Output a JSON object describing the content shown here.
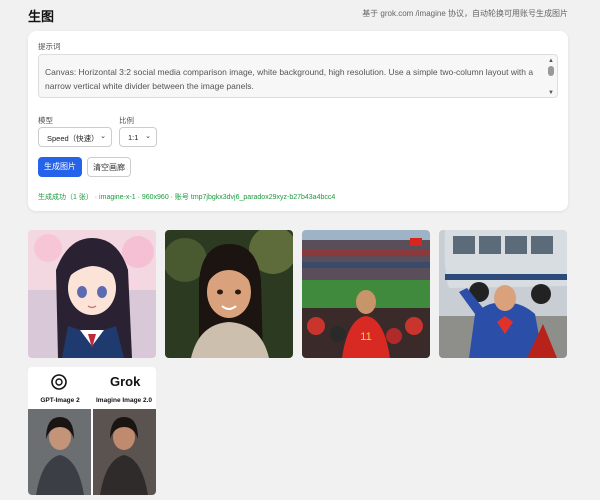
{
  "header": {
    "title": "生图",
    "note": "基于 grok.com /imagine 协议，自动轮换可用账号生成图片"
  },
  "form": {
    "prompt_label": "提示词",
    "prompt_text": "Canvas: Horizontal 3:2 social media comparison image, white background, high resolution. Use a simple two-column layout with a narrow vertical white divider between the image panels.",
    "model_label": "模型",
    "model_value": "Speed（快速）",
    "ratio_label": "比例",
    "ratio_value": "1:1",
    "generate_button": "生成图片",
    "clear_button": "清空画廊",
    "status": "生成成功（1 张） · imagine-x-1 · 960x960 · 账号 tmp7jbgkx3dvj6_paradox29xyz-b27b43a4bcc4"
  },
  "gallery": {
    "images": [
      {
        "name": "anime-girl-sailor-uniform"
      },
      {
        "name": "portrait-young-girl"
      },
      {
        "name": "stadium-soccer-fan"
      },
      {
        "name": "superman-lifting-bus"
      },
      {
        "name": "comparison-panel"
      }
    ],
    "comparison": {
      "left_label": "GPT-Image 2",
      "right_label": "Imagine Image 2.0",
      "grok_logo_text": "Grok"
    }
  },
  "colors": {
    "accent": "#2563eb",
    "success": "#1a9a3c",
    "background": "#f1f1f1"
  }
}
